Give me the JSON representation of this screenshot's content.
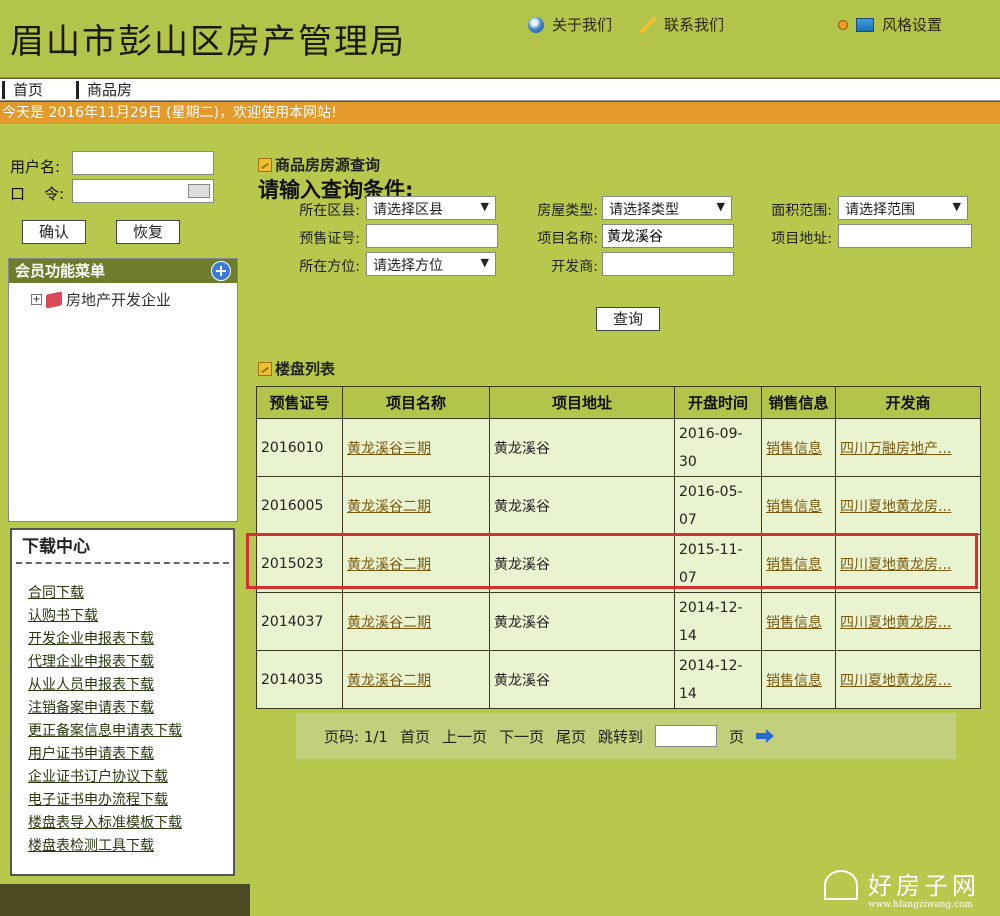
{
  "header": {
    "title": "眉山市彭山区房产管理局",
    "links": [
      {
        "label": "关于我们",
        "icon": "globe-icon"
      },
      {
        "label": "联系我们",
        "icon": "pencil-icon"
      },
      {
        "label": "风格设置",
        "icon": "monitor-icon"
      }
    ]
  },
  "nav": {
    "items": [
      "首页",
      "商品房"
    ]
  },
  "welcome": "今天是 2016年11月29日 (星期二)，欢迎使用本网站!",
  "login": {
    "username_label": "用户名:",
    "password_label": "口    令:",
    "confirm_label": "确认",
    "reset_label": "恢复"
  },
  "member_menu": {
    "title": "会员功能菜单",
    "tree_item": "房地产开发企业"
  },
  "download_center": {
    "title": "下载中心",
    "links": [
      "合同下载",
      "认购书下载",
      "开发企业申报表下载",
      "代理企业申报表下载",
      "从业人员申报表下载",
      "注销备案申请表下载",
      "更正备案信息申请表下载",
      "用户证书申请表下载",
      "企业证书订户协议下载",
      "电子证书申办流程下载",
      "楼盘表导入标准模板下载",
      "楼盘表检测工具下载"
    ]
  },
  "query": {
    "section_title": "商品房房源查询",
    "heading": "请输入查询条件:",
    "district_label": "所在区县:",
    "district_value": "请选择区县",
    "house_type_label": "房屋类型:",
    "house_type_value": "请选择类型",
    "area_label": "面积范围:",
    "area_value": "请选择范围",
    "presale_label": "预售证号:",
    "presale_value": "",
    "project_name_label": "项目名称:",
    "project_name_value": "黄龙溪谷",
    "project_addr_label": "项目地址:",
    "project_addr_value": "",
    "direction_label": "所在方位:",
    "direction_value": "请选择方位",
    "developer_label": "开发商:",
    "developer_value": "",
    "submit_label": "查询"
  },
  "listing": {
    "section_title": "楼盘列表",
    "columns": [
      "预售证号",
      "项目名称",
      "项目地址",
      "开盘时间",
      "销售信息",
      "开发商"
    ],
    "rows": [
      {
        "cert": "2016010",
        "name": "黄龙溪谷三期",
        "addr": "黄龙溪谷",
        "date1": "2016-09-",
        "date2": "30",
        "sale": "销售信息",
        "dev": "四川万融房地产..."
      },
      {
        "cert": "2016005",
        "name": "黄龙溪谷二期",
        "addr": "黄龙溪谷",
        "date1": "2016-05-",
        "date2": "07",
        "sale": "销售信息",
        "dev": "四川夏地黄龙房..."
      },
      {
        "cert": "2015023",
        "name": "黄龙溪谷二期",
        "addr": "黄龙溪谷",
        "date1": "2015-11-",
        "date2": "07",
        "sale": "销售信息",
        "dev": "四川夏地黄龙房..."
      },
      {
        "cert": "2014037",
        "name": "黄龙溪谷二期",
        "addr": "黄龙溪谷",
        "date1": "2014-12-",
        "date2": "14",
        "sale": "销售信息",
        "dev": "四川夏地黄龙房..."
      },
      {
        "cert": "2014035",
        "name": "黄龙溪谷二期",
        "addr": "黄龙溪谷",
        "date1": "2014-12-",
        "date2": "14",
        "sale": "销售信息",
        "dev": "四川夏地黄龙房..."
      }
    ]
  },
  "pager": {
    "page_info": "页码: 1/1",
    "first": "首页",
    "prev": "上一页",
    "next": "下一页",
    "last": "尾页",
    "jump": "跳转到",
    "page_unit": "页"
  },
  "watermark": {
    "text": "好房子网",
    "url": "www.hfangziwang.com"
  },
  "colors": {
    "header_bg": "#b3c44a",
    "welcome_bg": "#e39a2a",
    "highlight": "#d43030",
    "link": "#7a5a10"
  }
}
